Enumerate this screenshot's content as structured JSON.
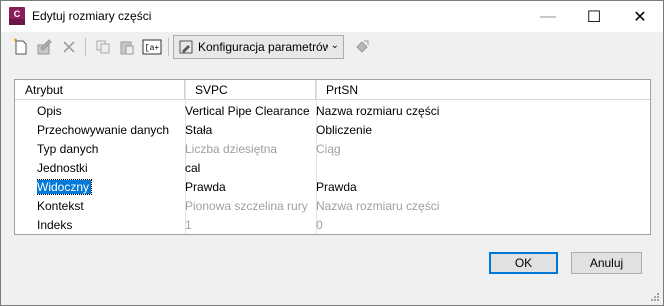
{
  "window": {
    "title": "Edytuj rozmiary części",
    "app_icon": "civil3d-icon",
    "minimize_glyph": "—",
    "maximize_glyph": "☐",
    "close_glyph": "✕"
  },
  "toolbar": {
    "config_label": "Konfiguracja parametrów",
    "icons": [
      "new-doc-icon",
      "edit-icon",
      "delete-icon",
      "copy-icon",
      "paste-icon",
      "rename-icon",
      "config-icon",
      "lock-icon"
    ],
    "rename_glyph": "[a+"
  },
  "grid": {
    "columns": [
      "Atrybut",
      "SVPC",
      "PrtSN"
    ],
    "rows": [
      {
        "attr": "Opis",
        "svpc": "Vertical Pipe Clearance",
        "prt": "Nazwa rozmiaru części",
        "disabled": false
      },
      {
        "attr": "Przechowywanie danych",
        "svpc": "Stała",
        "prt": "Obliczenie",
        "disabled": false
      },
      {
        "attr": "Typ danych",
        "svpc": "Liczba dziesiętna",
        "prt": "Ciąg",
        "disabled": true
      },
      {
        "attr": "Jednostki",
        "svpc": "cal",
        "prt": "",
        "disabled": false
      },
      {
        "attr": "Widoczny",
        "svpc": "Prawda",
        "prt": "Prawda",
        "disabled": false,
        "selected": true
      },
      {
        "attr": "Kontekst",
        "svpc": "Pionowa szczelina rury",
        "prt": "Nazwa rozmiaru części",
        "disabled": true
      },
      {
        "attr": "Indeks",
        "svpc": "1",
        "prt": "0",
        "disabled": true
      }
    ]
  },
  "buttons": {
    "ok": "OK",
    "cancel": "Anuluj"
  }
}
